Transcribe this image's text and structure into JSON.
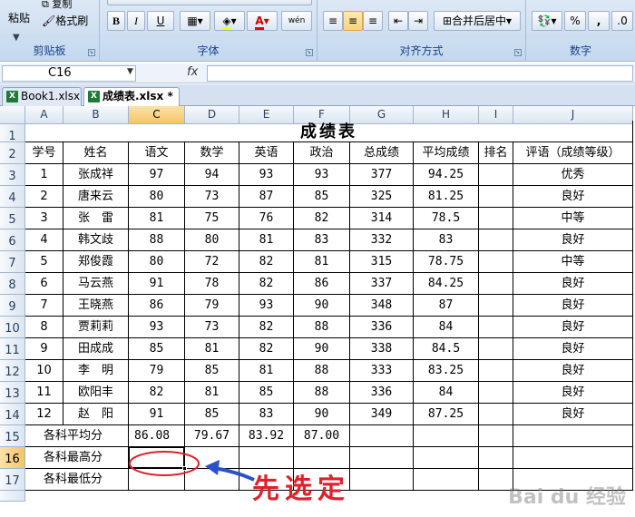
{
  "ribbon": {
    "clipboard": {
      "label": "剪贴板",
      "paste": "粘贴",
      "copy": "复制",
      "format_painter": "格式刷"
    },
    "font": {
      "label": "字体",
      "bold": "B",
      "italic": "I",
      "underline": "U",
      "font_color_glyph": "A",
      "phonetic": "wén"
    },
    "alignment": {
      "label": "对齐方式",
      "merge_center": "合并后居中"
    },
    "number": {
      "label": "数字",
      "percent": "%",
      "comma": ","
    }
  },
  "formula_bar": {
    "name_box": "C16",
    "fx": "fx",
    "content": ""
  },
  "workbook_tabs": [
    {
      "label": "Book1.xlsx",
      "active": false
    },
    {
      "label": "成绩表.xlsx *",
      "active": true
    }
  ],
  "columns": [
    "A",
    "B",
    "C",
    "D",
    "E",
    "F",
    "G",
    "H",
    "I",
    "J"
  ],
  "selected_column": "C",
  "selected_row": "16",
  "rows": [
    "1",
    "2",
    "3",
    "4",
    "5",
    "6",
    "7",
    "8",
    "9",
    "10",
    "11",
    "12",
    "13",
    "14",
    "15",
    "16",
    "17"
  ],
  "sheet": {
    "title": "成绩表",
    "headers": [
      "学号",
      "姓名",
      "语文",
      "数学",
      "英语",
      "政治",
      "总成绩",
      "平均成绩",
      "排名",
      "评语（成绩等级）"
    ],
    "records": [
      [
        "1",
        "张成祥",
        "97",
        "94",
        "93",
        "93",
        "377",
        "94.25",
        "",
        "优秀"
      ],
      [
        "2",
        "唐来云",
        "80",
        "73",
        "87",
        "85",
        "325",
        "81.25",
        "",
        "良好"
      ],
      [
        "3",
        "张　雷",
        "81",
        "75",
        "76",
        "82",
        "314",
        "78.5",
        "",
        "中等"
      ],
      [
        "4",
        "韩文歧",
        "88",
        "80",
        "81",
        "83",
        "332",
        "83",
        "",
        "良好"
      ],
      [
        "5",
        "郑俊霞",
        "80",
        "72",
        "82",
        "81",
        "315",
        "78.75",
        "",
        "中等"
      ],
      [
        "6",
        "马云燕",
        "91",
        "78",
        "82",
        "86",
        "337",
        "84.25",
        "",
        "良好"
      ],
      [
        "7",
        "王晓燕",
        "86",
        "79",
        "93",
        "90",
        "348",
        "87",
        "",
        "良好"
      ],
      [
        "8",
        "贾莉莉",
        "93",
        "73",
        "82",
        "88",
        "336",
        "84",
        "",
        "良好"
      ],
      [
        "9",
        "田成成",
        "85",
        "81",
        "82",
        "90",
        "338",
        "84.5",
        "",
        "良好"
      ],
      [
        "10",
        "李　明",
        "79",
        "85",
        "81",
        "88",
        "333",
        "83.25",
        "",
        "良好"
      ],
      [
        "11",
        "欧阳丰",
        "82",
        "81",
        "85",
        "88",
        "336",
        "84",
        "",
        "良好"
      ],
      [
        "12",
        "赵　阳",
        "91",
        "85",
        "83",
        "90",
        "349",
        "87.25",
        "",
        "良好"
      ]
    ],
    "avg_label": "各科平均分",
    "avg_values": [
      "86.08",
      "79.67",
      "83.92",
      "87.00"
    ],
    "max_label": "各科最高分",
    "min_label": "各科最低分"
  },
  "annotation": {
    "text": "先选定",
    "color": "#e0202a"
  },
  "watermark": "Bai du 经验"
}
